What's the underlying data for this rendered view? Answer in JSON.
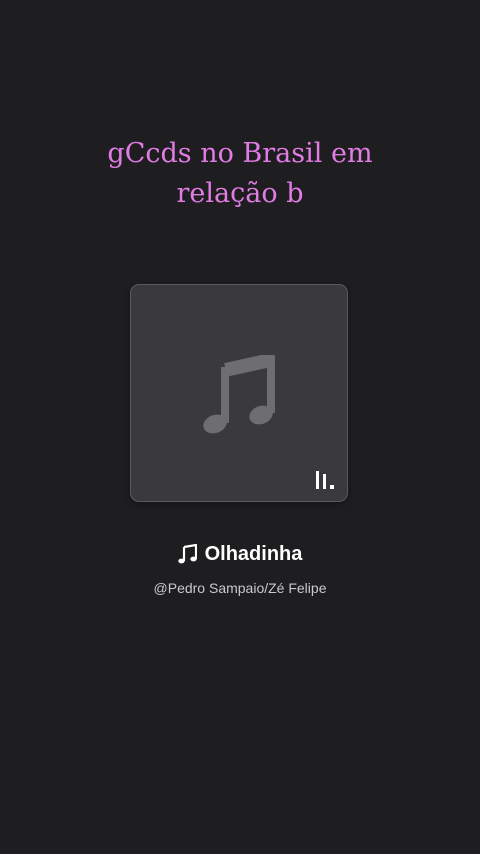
{
  "caption": {
    "line1": "gCcds no Brasil em",
    "line2": "relação b"
  },
  "artwork": {
    "icon": "music-note-icon",
    "badge_icon": "equalizer-bars-icon"
  },
  "track": {
    "icon": "music-note-icon",
    "title": "Olhadinha",
    "artist": "@Pedro Sampaio/Zé Felipe"
  },
  "colors": {
    "background": "#1e1d1f",
    "caption": "#e07ce4",
    "artwork_bg": "#3a393b",
    "title": "#ffffff",
    "artist": "#c9c8cb"
  }
}
